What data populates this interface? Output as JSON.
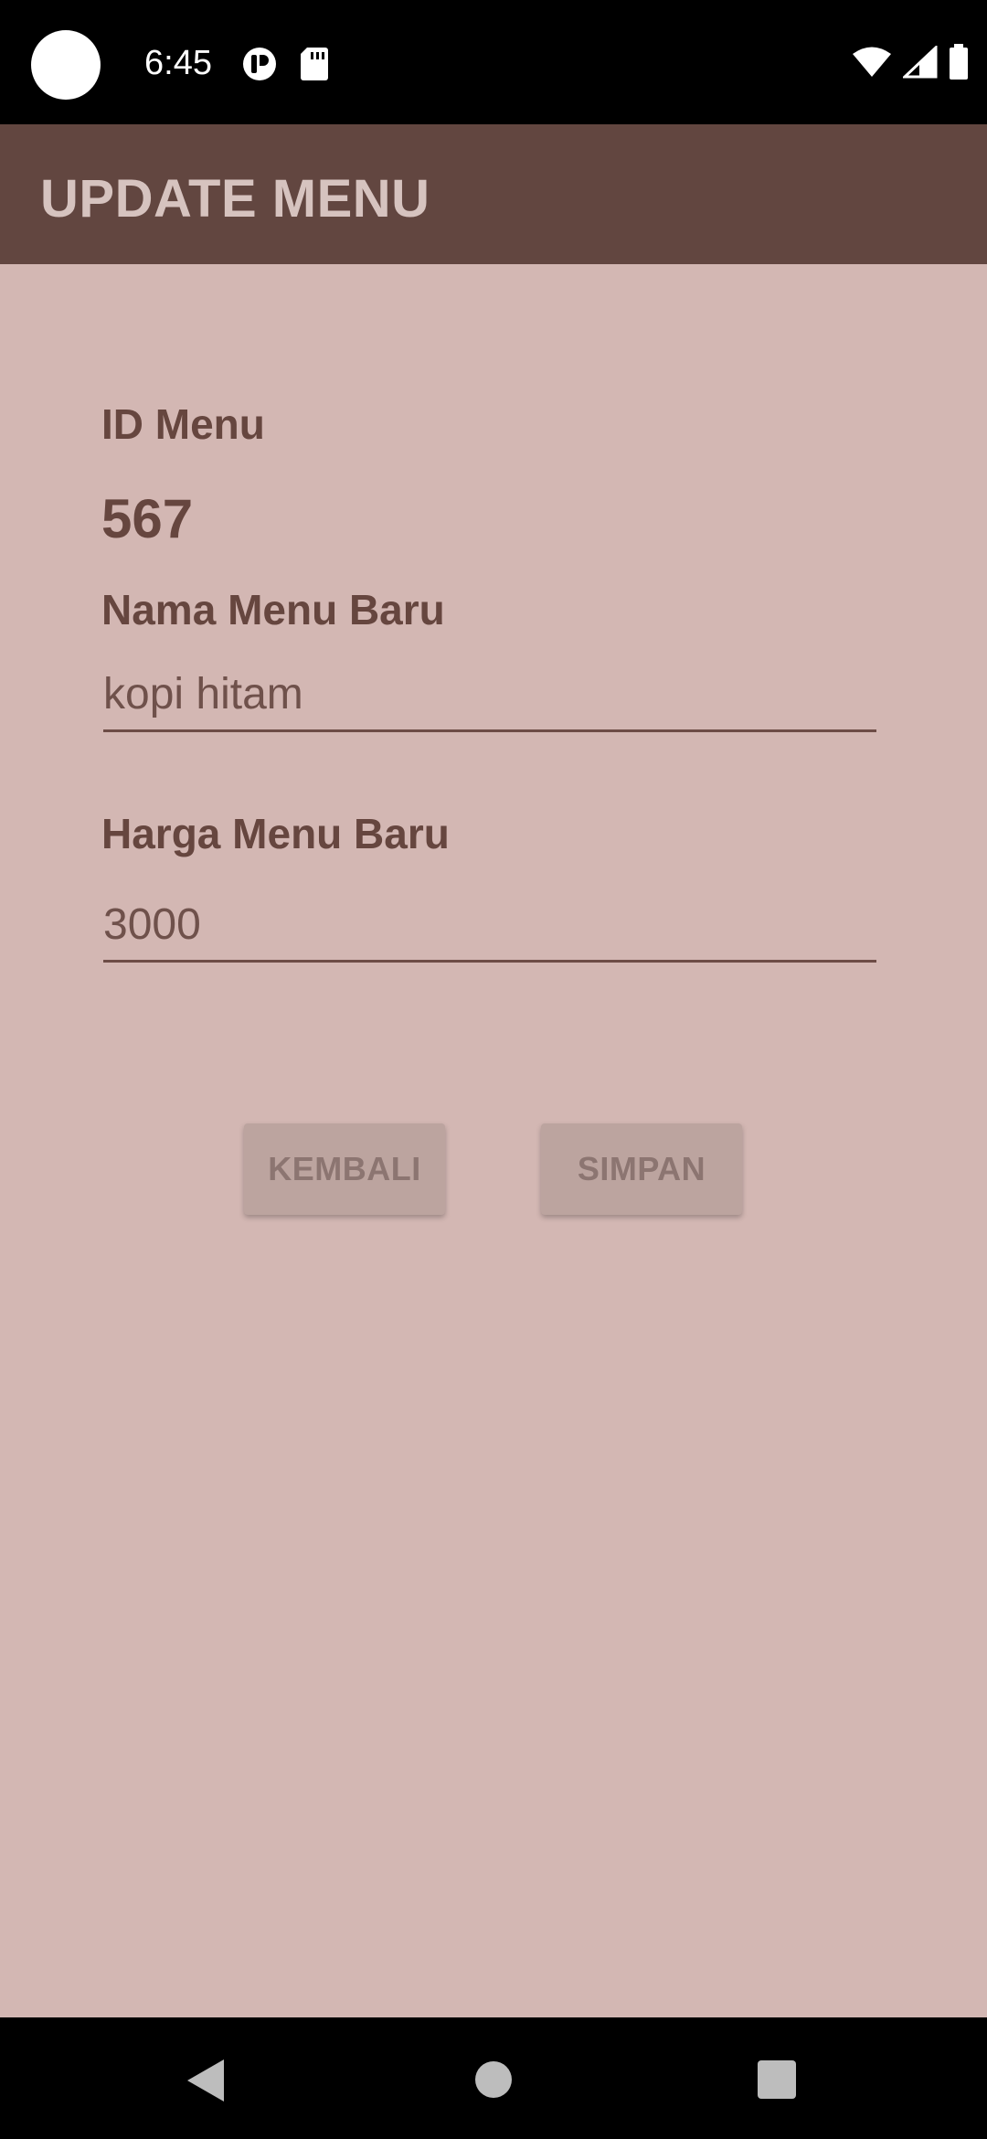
{
  "status_bar": {
    "time": "6:45"
  },
  "app_bar": {
    "title": "UPDATE MENU"
  },
  "form": {
    "id_label": "ID Menu",
    "id_value": "567",
    "name_label": "Nama Menu Baru",
    "name_value": "kopi hitam",
    "price_label": "Harga Menu Baru",
    "price_value": "3000"
  },
  "buttons": {
    "back_label": "KEMBALI",
    "save_label": "SIMPAN"
  },
  "colors": {
    "app_bar": "#624640",
    "background": "#d3b7b3",
    "text": "#66463f",
    "button": "#bca49f"
  }
}
